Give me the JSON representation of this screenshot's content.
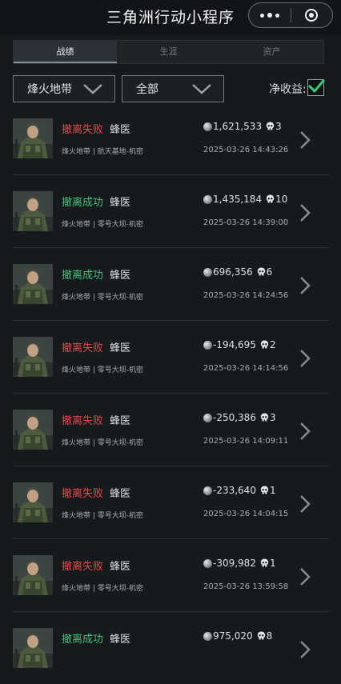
{
  "header": {
    "title": "三角洲行动小程序"
  },
  "tabs": [
    {
      "label": "战绩",
      "active": true
    },
    {
      "label": "生涯",
      "active": false
    },
    {
      "label": "资产",
      "active": false
    }
  ],
  "filters": {
    "map_select": {
      "value": "烽火地带"
    },
    "mode_select": {
      "value": "全部"
    },
    "net_income_label": "净收益:",
    "net_income_checked": true
  },
  "colors": {
    "success": "#43c27a",
    "failure": "#e34a4a",
    "checkbox": "#39c56e"
  },
  "records": [
    {
      "status": "撤离失败",
      "result": "fail",
      "operator": "蜂医",
      "map": "烽火地带 | 航天基地-机密",
      "value": "1,621,533",
      "kills": "3",
      "time": "2025-03-26 14:43:26"
    },
    {
      "status": "撤离成功",
      "result": "ok",
      "operator": "蜂医",
      "map": "烽火地带 | 零号大坝-机密",
      "value": "1,435,184",
      "kills": "10",
      "time": "2025-03-26 14:39:00"
    },
    {
      "status": "撤离成功",
      "result": "ok",
      "operator": "蜂医",
      "map": "烽火地带 | 零号大坝-机密",
      "value": "696,356",
      "kills": "6",
      "time": "2025-03-26 14:24:56"
    },
    {
      "status": "撤离失败",
      "result": "fail",
      "operator": "蜂医",
      "map": "烽火地带 | 零号大坝-机密",
      "value": "-194,695",
      "kills": "2",
      "time": "2025-03-26 14:14:56"
    },
    {
      "status": "撤离失败",
      "result": "fail",
      "operator": "蜂医",
      "map": "烽火地带 | 零号大坝-机密",
      "value": "-250,386",
      "kills": "3",
      "time": "2025-03-26 14:09:11"
    },
    {
      "status": "撤离失败",
      "result": "fail",
      "operator": "蜂医",
      "map": "烽火地带 | 零号大坝-机密",
      "value": "-233,640",
      "kills": "1",
      "time": "2025-03-26 14:04:15"
    },
    {
      "status": "撤离失败",
      "result": "fail",
      "operator": "蜂医",
      "map": "烽火地带 | 零号大坝-机密",
      "value": "-309,982",
      "kills": "1",
      "time": "2025-03-26 13:59:58"
    },
    {
      "status": "撤离成功",
      "result": "ok",
      "operator": "蜂医",
      "map": "",
      "value": "975,020",
      "kills": "8",
      "time": ""
    }
  ],
  "icons": {
    "coin": "coin-icon",
    "kills": "skull-icon",
    "row_arrow": "chevron-right-icon",
    "capsule_more": "more-dots-icon",
    "capsule_close": "close-circle-icon"
  }
}
